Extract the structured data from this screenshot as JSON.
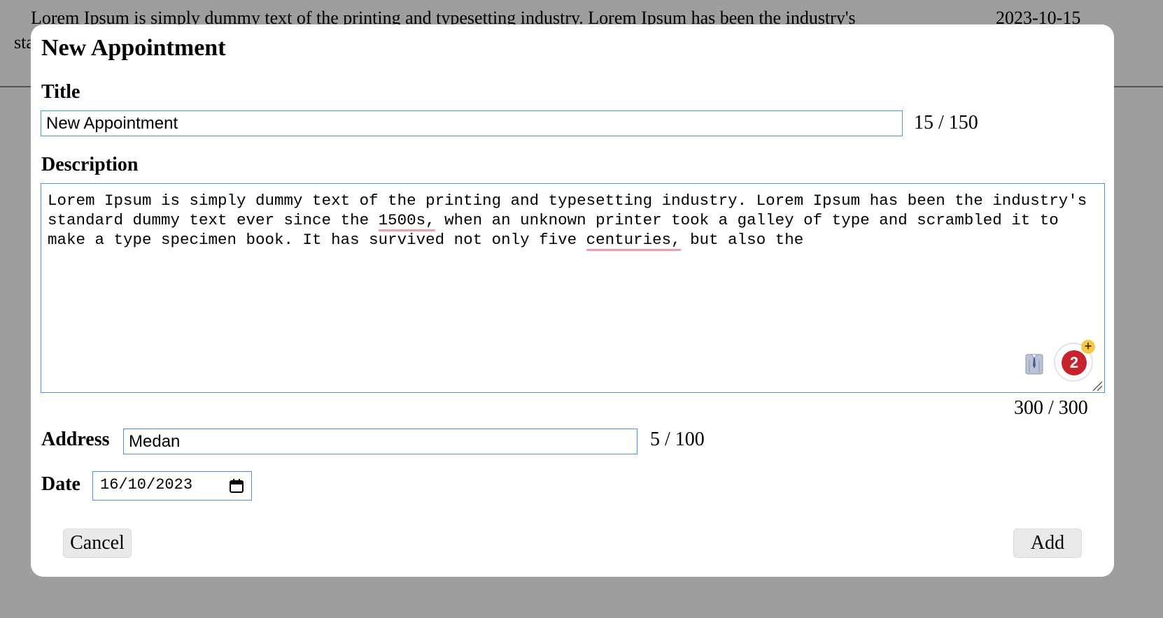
{
  "background": {
    "row_description_line1": "Lorem Ipsum is simply dummy text of the printing and typesetting industry. Lorem Ipsum has been the industry's",
    "row_description_line2": "standard",
    "row_date": "2023-10-15"
  },
  "dialog": {
    "title": "New Appointment",
    "title_field": {
      "label": "Title",
      "value": "New Appointment",
      "counter": "15 / 150"
    },
    "description_field": {
      "label": "Description",
      "text_before_1500s": "Lorem Ipsum is simply dummy text of the printing and typesetting industry. Lorem Ipsum has been the industry's standard dummy text ever since the ",
      "misspelled_1": "1500s,",
      "text_middle": " when an unknown printer took a galley of type and scrambled it to make a type specimen book. It has survived not only five ",
      "misspelled_2": "centuries,",
      "text_after": " but also the",
      "counter": "300 / 300",
      "extension_badge_count": "2",
      "extension_badge_plus": "+",
      "icons": [
        "tie-icon",
        "extension-badge-icon",
        "resize-grip-icon"
      ]
    },
    "address_field": {
      "label": "Address",
      "value": "Medan",
      "counter": "5 / 100"
    },
    "date_field": {
      "label": "Date",
      "value": "16/10/2023"
    },
    "buttons": {
      "cancel": "Cancel",
      "add": "Add"
    }
  },
  "colors": {
    "overlay": "#9e9e9e",
    "focus_border": "#4a90e2",
    "spell_underline": "#e8a0aa",
    "badge_red": "#c8232c",
    "badge_plus": "#f5c843",
    "button_bg": "#e9e9e9"
  }
}
